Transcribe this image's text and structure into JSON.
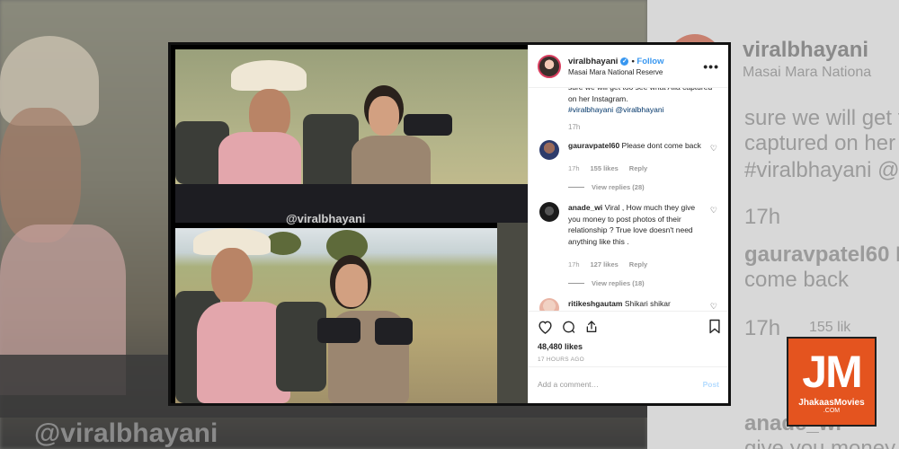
{
  "header": {
    "username": "viralbhayani",
    "follow_label": "Follow",
    "location": "Masai Mara National Reserve",
    "more_label": "•••"
  },
  "photo": {
    "watermark": "@viralbhayani"
  },
  "caption": {
    "text": "sure we will get too see what Alia captured on her Instagram.",
    "hashtag": "#viralbhayani",
    "mention": "@viralbhayani",
    "time": "17h"
  },
  "comments": [
    {
      "user": "gauravpatel60",
      "text": "Please dont come back",
      "time": "17h",
      "likes": "155 likes",
      "reply_label": "Reply",
      "view_replies": "View replies (28)"
    },
    {
      "user": "anade_wi",
      "text": "Viral , How much they give you money to post photos of their relationship ? True love doesn't need anything like this .",
      "time": "17h",
      "likes": "127 likes",
      "reply_label": "Reply",
      "view_replies": "View replies (18)"
    },
    {
      "user": "ritikeshgautam",
      "text": "Shikari shikar"
    }
  ],
  "actions": {
    "likes": "48,480 likes",
    "ago": "17 HOURS AGO"
  },
  "comment_box": {
    "placeholder": "Add a comment…",
    "post_label": "Post"
  },
  "background": {
    "username": "viralbhayani",
    "location": "Masai Mara Nationa",
    "cap_line1": "sure we will get t",
    "cap_line2": "captured on her I",
    "cap_line3": "#viralbhayani @v",
    "time": "17h",
    "comment_user": "gauravpatel60 P",
    "comment_text": "come back",
    "time2": "17h",
    "likes_frag": "155 lik",
    "anade": "anade_wi",
    "give": "give you money",
    "watermark": "@viralbhayani"
  },
  "logo": {
    "mark": "JM",
    "name": "JhakaasMovies",
    "suffix": ".COM"
  },
  "colors": {
    "accent": "#3897f0",
    "logo_bg": "#e4541f"
  }
}
